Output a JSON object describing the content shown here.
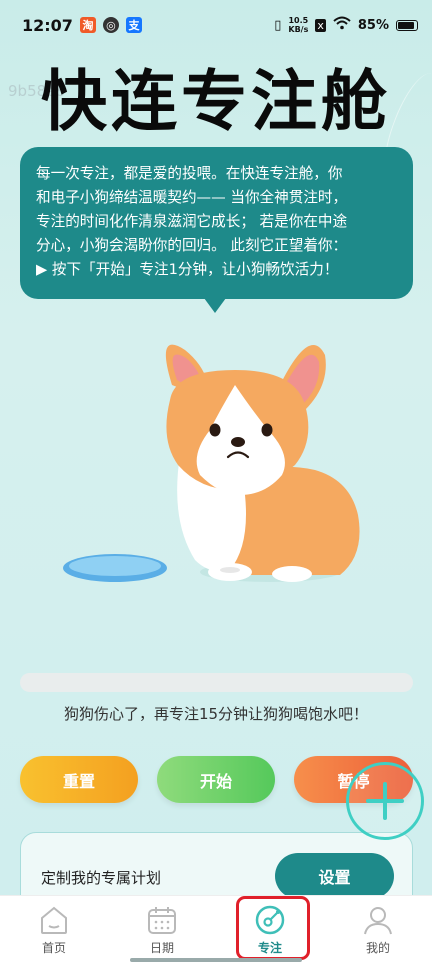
{
  "status_bar": {
    "time": "12:07",
    "net_speed_value": "10.5",
    "net_speed_unit": "KB/s",
    "battery": "85%"
  },
  "title": "快连专注舱",
  "watermark": "9b58e8",
  "bubble": {
    "line1": "每一次专注，都是爱的投喂。在快连专注舱，你",
    "line2": "和电子小狗缔结温暖契约—— 当你全神贯注时，",
    "line3": "专注的时间化作清泉滋润它成长； 若是你在中途",
    "line4": "分心，小狗会渴盼你的回归。 此刻它正望着你：",
    "line5": "▶ 按下「开始」专注1分钟，让小狗畅饮活力！"
  },
  "progress": {
    "value": 0
  },
  "status_message": "狗狗伤心了，再专注15分钟让狗狗喝饱水吧！",
  "buttons": {
    "reset": "重置",
    "start": "开始",
    "pause": "暂停"
  },
  "plan": {
    "label": "定制我的专属计划",
    "button": "设置"
  },
  "nav": {
    "items": [
      {
        "label": "首页",
        "icon": "home-icon"
      },
      {
        "label": "日期",
        "icon": "calendar-icon"
      },
      {
        "label": "专注",
        "icon": "focus-icon"
      },
      {
        "label": "我的",
        "icon": "profile-icon"
      }
    ],
    "active": "专注"
  },
  "colors": {
    "accent": "#1e8a8a",
    "reset": "#f4a020",
    "start": "#55c95b",
    "pause": "#ec5f3a",
    "highlight": "#e0202a"
  }
}
